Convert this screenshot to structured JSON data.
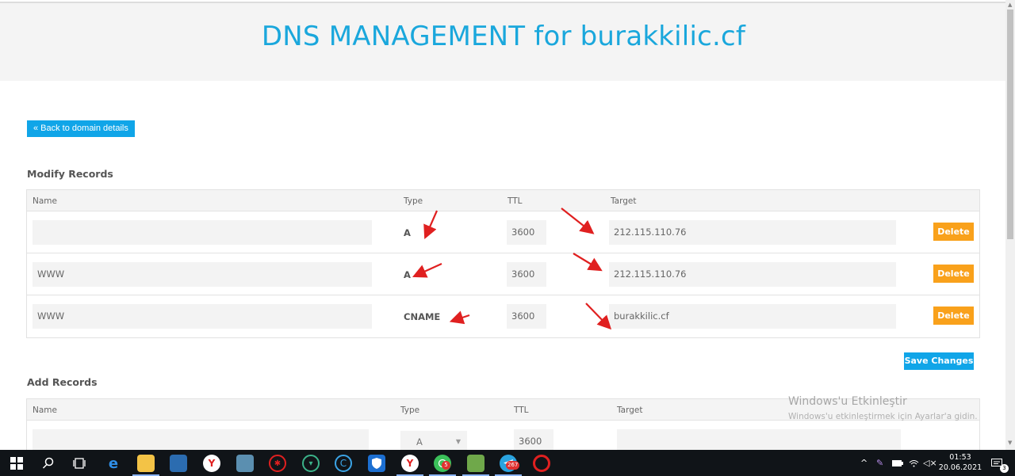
{
  "header": {
    "title": "DNS MANAGEMENT for burakkilic.cf"
  },
  "back_button": {
    "label": "« Back to domain details"
  },
  "modify": {
    "title": "Modify Records",
    "columns": [
      "Name",
      "Type",
      "TTL",
      "Target"
    ],
    "rows": [
      {
        "name": "",
        "type": "A",
        "ttl": "3600",
        "target": "212.115.110.76",
        "delete": "Delete"
      },
      {
        "name": "WWW",
        "type": "A",
        "ttl": "3600",
        "target": "212.115.110.76",
        "delete": "Delete"
      },
      {
        "name": "WWW",
        "type": "CNAME",
        "ttl": "3600",
        "target": "burakkilic.cf",
        "delete": "Delete"
      }
    ],
    "save_label": "Save Changes"
  },
  "add": {
    "title": "Add Records",
    "columns": [
      "Name",
      "Type",
      "TTL",
      "Target"
    ],
    "row": {
      "name": "",
      "type": "A",
      "ttl": "3600",
      "target": ""
    }
  },
  "watermark": {
    "title": "Windows'u Etkinleştir",
    "subtitle": "Windows'u etkinleştirmek için Ayarlar'a gidin."
  },
  "taskbar": {
    "whatsapp_badge": "5",
    "telegram_badge": "267",
    "time": "01:53",
    "date": "20.06.2021",
    "notification_count": "3"
  },
  "colors": {
    "accent": "#10a5e8",
    "title": "#1aa7dc",
    "delete": "#f9a11b",
    "arrow": "#e02020"
  }
}
